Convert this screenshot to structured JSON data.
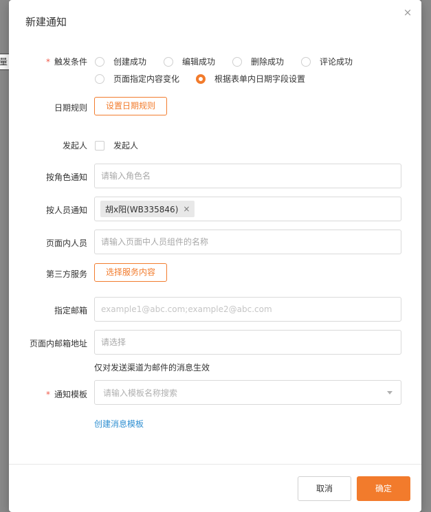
{
  "background": {
    "partial_label": "量"
  },
  "modal": {
    "title": "新建通知",
    "close_symbol": "×"
  },
  "form": {
    "trigger": {
      "label": "触发条件",
      "required_mark": "*",
      "options": [
        "创建成功",
        "编辑成功",
        "删除成功",
        "评论成功",
        "页面指定内容变化",
        "根据表单内日期字段设置"
      ],
      "selected": "根据表单内日期字段设置"
    },
    "date_rule": {
      "label": "日期规则",
      "button": "设置日期规则"
    },
    "initiator": {
      "label": "发起人",
      "checkbox_label": "发起人",
      "checked": false
    },
    "by_role": {
      "label": "按角色通知",
      "placeholder": "请输入角色名"
    },
    "by_person": {
      "label": "按人员通知",
      "tags": [
        "胡x阳(WB335846)"
      ],
      "tag_remove": "×"
    },
    "page_person": {
      "label": "页面内人员",
      "placeholder": "请输入页面中人员组件的名称"
    },
    "third_party": {
      "label": "第三方服务",
      "button": "选择服务内容"
    },
    "email": {
      "label": "指定邮箱",
      "placeholder": "example1@abc.com;example2@abc.com"
    },
    "page_email": {
      "label": "页面内邮箱地址",
      "placeholder": "请选择",
      "hint": "仅对发送渠道为邮件的消息生效"
    },
    "template": {
      "label": "通知模板",
      "required_mark": "*",
      "placeholder": "请输入模板名称搜索",
      "create_link": "创建消息模板"
    }
  },
  "footer": {
    "cancel": "取消",
    "ok": "确定"
  },
  "colors": {
    "accent": "#f27b2c",
    "link": "#2f8fd1",
    "required": "#f05a4a"
  }
}
